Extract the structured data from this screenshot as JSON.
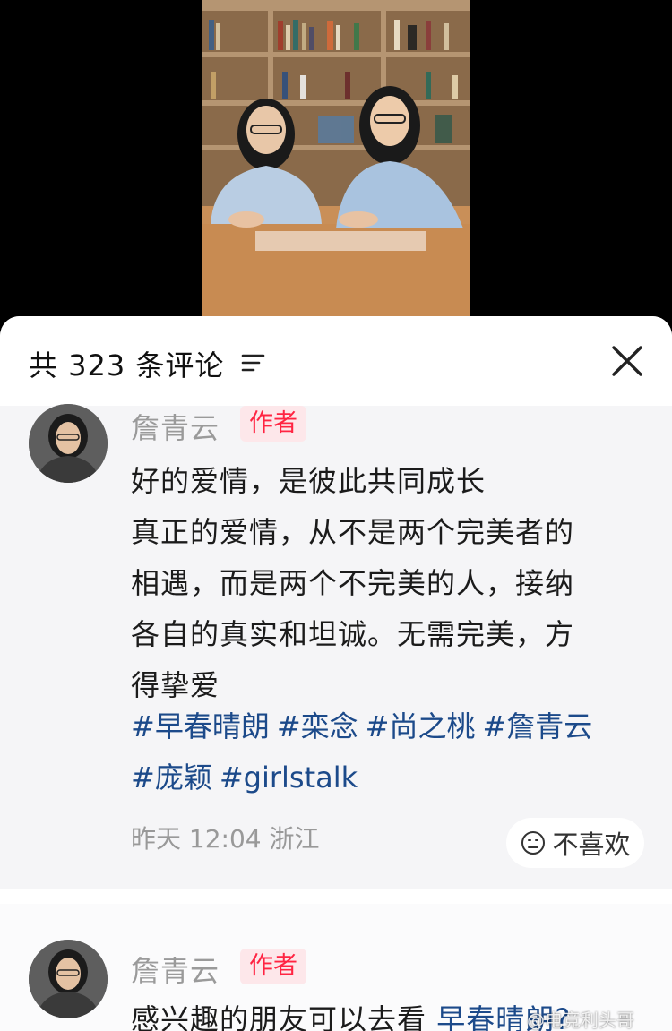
{
  "header": {
    "comment_count_label": "共 323 条评论"
  },
  "comments": [
    {
      "author": "詹青云",
      "author_tag": "作者",
      "lines": [
        "好的爱情，是彼此共同成长",
        "真正的爱情，从不是两个完美者的",
        "相遇，而是两个不完美的人，接纳",
        "各自的真实和坦诚。无需完美，方",
        "得挚爱"
      ],
      "hashtags": [
        "#早春晴朗",
        "#栾念",
        "#尚之桃",
        "#詹青云",
        "#庞颖",
        "#girlstalk"
      ],
      "meta": "昨天 12:04 浙江",
      "dislike_label": "不喜欢"
    },
    {
      "author": "詹青云",
      "author_tag": "作者",
      "text_prefix": "感兴趣的朋友可以去看 ",
      "text_link": "早春晴朗?"
    }
  ],
  "watermark": "@电竞利头哥",
  "colors": {
    "author_tag": "#ff2442",
    "hashtag": "#1c4a8a",
    "sheet_bg": "#f5f5f7"
  }
}
